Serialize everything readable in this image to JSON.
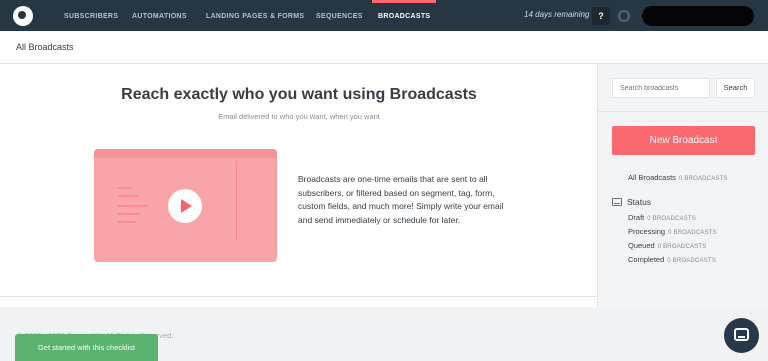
{
  "topnav": {
    "items": [
      {
        "label": "SUBSCRIBERS"
      },
      {
        "label": "AUTOMATIONS"
      },
      {
        "label": "LANDING PAGES & FORMS"
      },
      {
        "label": "SEQUENCES"
      },
      {
        "label": "BROADCASTS"
      }
    ],
    "active_item": "BROADCASTS",
    "trial_text": "14 days remaining",
    "help_label": "?"
  },
  "page_title": "All Broadcasts",
  "main": {
    "headline": "Reach exactly who you want using Broadcasts",
    "subline": "Email delivered to who you want, when you want",
    "description": "Broadcasts are one-time emails that are sent to all subscribers, or filtered based on segment, tag, form, custom fields, and much more! Simply write your email and send immediately or schedule for later."
  },
  "sidebar": {
    "search_placeholder": "Search broadcasts",
    "search_button": "Search",
    "new_button": "New Broadcast",
    "all_broadcasts": {
      "label": "All Broadcasts",
      "count": "0 BROADCASTS"
    },
    "status_label": "Status",
    "statuses": [
      {
        "label": "Draft",
        "count": "0 BROADCASTS"
      },
      {
        "label": "Processing",
        "count": "0 BROADCASTS"
      },
      {
        "label": "Queued",
        "count": "0 BROADCASTS"
      },
      {
        "label": "Completed",
        "count": "0 BROADCASTS"
      }
    ]
  },
  "footer": {
    "copyright": "© 2013 - 2020 ConvertKit. All Rights Reserved.",
    "checklist_button": "Get started with this checklist"
  },
  "colors": {
    "nav_bg": "#263743",
    "accent": "#fb6970",
    "checklist": "#5ab36f",
    "chat": "#27384a"
  },
  "icons": [
    "logo-icon",
    "help-icon",
    "spinner-icon",
    "play-icon",
    "status-icon",
    "chat-icon"
  ]
}
